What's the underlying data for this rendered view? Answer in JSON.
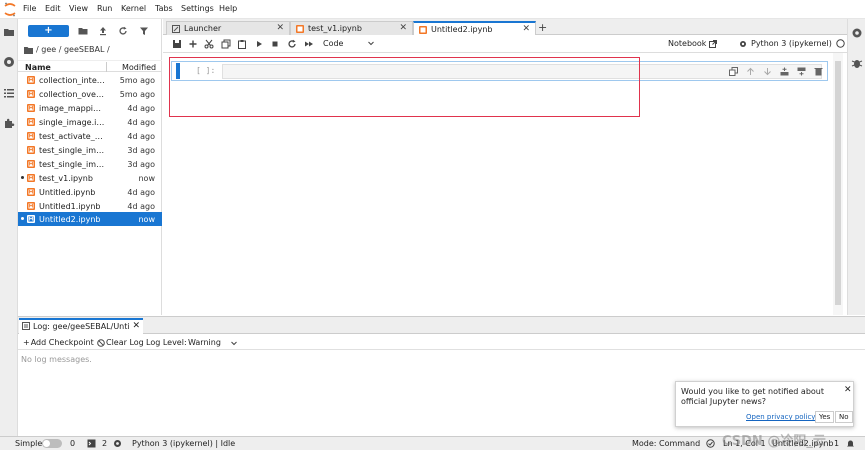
{
  "menubar": {
    "items": [
      "File",
      "Edit",
      "View",
      "Run",
      "Kernel",
      "Tabs",
      "Settings",
      "Help"
    ]
  },
  "filebrowser": {
    "new_label": "+",
    "breadcrumb": "/ gee / geeSEBAL /",
    "columns": {
      "name": "Name",
      "modified": "Modified"
    },
    "files": [
      {
        "name": "collection_interp...",
        "modified": "5mo ago"
      },
      {
        "name": "collection_overp...",
        "modified": "5mo ago"
      },
      {
        "name": "image_mapping....",
        "modified": "4d ago"
      },
      {
        "name": "single_image.ipy...",
        "modified": "4d ago"
      },
      {
        "name": "test_activate_v1.i...",
        "modified": "4d ago"
      },
      {
        "name": "test_single_imag...",
        "modified": "3d ago"
      },
      {
        "name": "test_single_imag...",
        "modified": "3d ago"
      },
      {
        "name": "test_v1.ipynb",
        "modified": "now"
      },
      {
        "name": "Untitled.ipynb",
        "modified": "4d ago"
      },
      {
        "name": "Untitled1.ipynb",
        "modified": "4d ago"
      },
      {
        "name": "Untitled2.ipynb",
        "modified": "now"
      }
    ]
  },
  "tabs": [
    {
      "label": "Launcher",
      "icon": "rocket-icon"
    },
    {
      "label": "test_v1.ipynb",
      "icon": "notebook-icon"
    },
    {
      "label": "Untitled2.ipynb",
      "icon": "notebook-icon"
    }
  ],
  "toolbar": {
    "cell_type": "Code",
    "notebook_label": "Notebook",
    "kernel_label": "Python 3 (ipykernel)"
  },
  "cell": {
    "prompt": "[ ]:"
  },
  "log": {
    "tab_label": "Log: gee/geeSEBAL/Untitle",
    "add_checkpoint": "Add Checkpoint",
    "clear_log": "Clear Log",
    "level_label": "Log Level:",
    "level_value": "Warning",
    "empty": "No log messages."
  },
  "notification": {
    "text": "Would you like to get notified about official Jupyter news?",
    "privacy": "Open privacy policy",
    "yes": "Yes",
    "no": "No"
  },
  "statusbar": {
    "simple": "Simple",
    "terminals": "0",
    "kernels": "2",
    "kernel": "Python 3 (ipykernel) | Idle",
    "mode": "Mode: Command",
    "position": "Ln 1, Col 1",
    "filename": "Untitled2.ipynb",
    "count": "1"
  },
  "watermark": "CSDN @冷阳_云",
  "colors": {
    "accent": "#1976d2",
    "highlight": "#e0334d",
    "notebook_orange": "#f37726"
  }
}
